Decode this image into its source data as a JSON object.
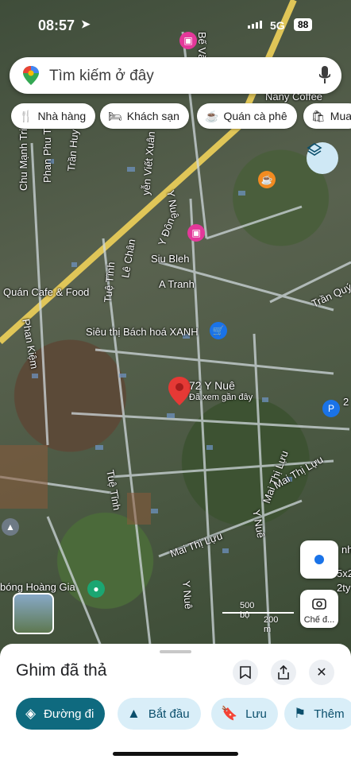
{
  "status": {
    "time": "08:57",
    "network": "5G",
    "battery": "88"
  },
  "search": {
    "placeholder": "Tìm kiếm ở đây"
  },
  "chips": [
    {
      "label": "Nhà hàng",
      "icon": "fork-knife-icon"
    },
    {
      "label": "Khách sạn",
      "icon": "bed-icon"
    },
    {
      "label": "Quán cà phê",
      "icon": "coffee-cup-icon"
    },
    {
      "label": "Mua",
      "icon": "shopping-bag-icon"
    }
  ],
  "map_labels": {
    "nany_coffee": "Nany Coffee",
    "phan_phu_tien": "Phan Phu T",
    "tran_huy": "Trần Huy",
    "chu_manh_trinh": "Chu Mạnh Trinh",
    "nguyen_viet_xuan": "yễn Viết Xuân",
    "y_nue_top": "Y Nuê",
    "y_don": "Y Đôn",
    "le_chan": "Lê Chân",
    "siu_bleh": "Siu Bleh",
    "a_tranh": "A Tranh",
    "quan_cafe_food": "Quán Cafe & Food",
    "tran_quy": "Trần Quý",
    "phan_kiem": "Phan Kiệm",
    "tue_tinh_top": "Tuệ Tĩnh",
    "sieu_thi": "Siêu thị Bách hoá XANH",
    "tue_tinh": "Tuệ Tĩnh",
    "mai_thi_luu_1": "Mai Thị Lựu",
    "mai_thi_luu_2": "Mai Thị Lựu",
    "mai_thi_luu_3": "Mai Thị Lựu",
    "y_nue_mid": "Y Nuê",
    "y_nue_bottom": "Y Nuê",
    "bong_hoang_gia": "bóng Hoàng Gia",
    "be_van": "Bế Vă",
    "right_edge_1": "2",
    "right_edge_2": "nh",
    "right_edge_3": "5x2",
    "right_edge_4": "2ty"
  },
  "place": {
    "title": "72 Y Nuê",
    "subtitle": "Đã xem gần đây"
  },
  "scale": {
    "imperial": "500 bộ",
    "metric": "200 m"
  },
  "mode_button": {
    "label": "Chế đ..."
  },
  "sheet": {
    "title": "Ghim đã thả"
  },
  "actions": [
    {
      "label": "Đường đi",
      "icon": "directions-icon"
    },
    {
      "label": "Bắt đầu",
      "icon": "navigation-arrow-icon"
    },
    {
      "label": "Lưu",
      "icon": "bookmark-icon"
    },
    {
      "label": "Thêm",
      "icon": "flag-icon"
    }
  ],
  "colors": {
    "pin": "#e53935",
    "primary": "#0f6a7f",
    "accent": "#1a73e8",
    "hotel_poi": "#e4389a"
  }
}
